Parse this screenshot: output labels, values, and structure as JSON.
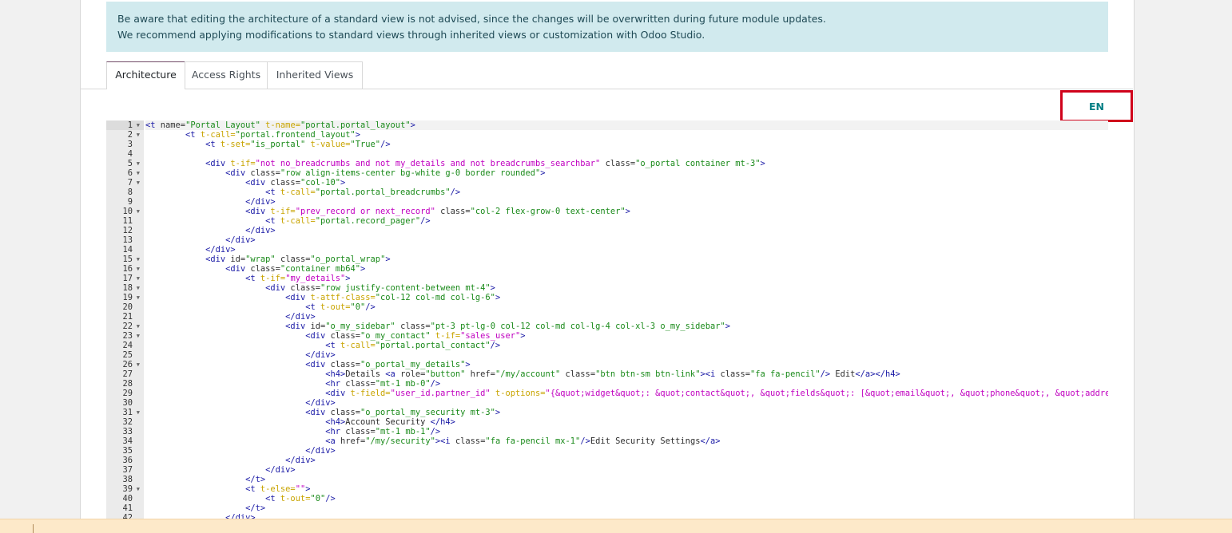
{
  "alert": {
    "line1": "Be aware that editing the architecture of a standard view is not advised, since the changes will be overwritten during future module updates.",
    "line2": "We recommend applying modifications to standard views through inherited views or customization with Odoo Studio."
  },
  "tabs": [
    {
      "label": "Architecture"
    },
    {
      "label": "Access Rights"
    },
    {
      "label": "Inherited Views"
    }
  ],
  "lang_button": {
    "label": "EN"
  },
  "code": {
    "lines": [
      {
        "n": "1",
        "fold": true,
        "tokens": [
          [
            "tag",
            "<t"
          ],
          [
            "attr",
            " name="
          ],
          [
            "str",
            "\"Portal Layout\""
          ],
          [
            "qattr",
            " t-name="
          ],
          [
            "str",
            "\"portal.portal_layout\""
          ],
          [
            "tag",
            ">"
          ]
        ]
      },
      {
        "n": "2",
        "fold": true,
        "tokens": [
          [
            "plain",
            "        "
          ],
          [
            "tag",
            "<t"
          ],
          [
            "qattr",
            " t-call="
          ],
          [
            "str",
            "\"portal.frontend_layout\""
          ],
          [
            "tag",
            ">"
          ]
        ]
      },
      {
        "n": "3",
        "fold": false,
        "tokens": [
          [
            "plain",
            "            "
          ],
          [
            "tag",
            "<t"
          ],
          [
            "qattr",
            " t-set="
          ],
          [
            "str",
            "\"is_portal\""
          ],
          [
            "qattr",
            " t-value="
          ],
          [
            "str",
            "\"True\""
          ],
          [
            "tag",
            "/>"
          ]
        ]
      },
      {
        "n": "4",
        "fold": false,
        "tokens": []
      },
      {
        "n": "5",
        "fold": true,
        "tokens": [
          [
            "plain",
            "            "
          ],
          [
            "tag",
            "<div"
          ],
          [
            "qattr",
            " t-if="
          ],
          [
            "qstr",
            "\"not no_breadcrumbs and not my_details and not breadcrumbs_searchbar\""
          ],
          [
            "attr",
            " class="
          ],
          [
            "str",
            "\"o_portal container mt-3\""
          ],
          [
            "tag",
            ">"
          ]
        ]
      },
      {
        "n": "6",
        "fold": true,
        "tokens": [
          [
            "plain",
            "                "
          ],
          [
            "tag",
            "<div"
          ],
          [
            "attr",
            " class="
          ],
          [
            "str",
            "\"row align-items-center bg-white g-0 border rounded\""
          ],
          [
            "tag",
            ">"
          ]
        ]
      },
      {
        "n": "7",
        "fold": true,
        "tokens": [
          [
            "plain",
            "                    "
          ],
          [
            "tag",
            "<div"
          ],
          [
            "attr",
            " class="
          ],
          [
            "str",
            "\"col-10\""
          ],
          [
            "tag",
            ">"
          ]
        ]
      },
      {
        "n": "8",
        "fold": false,
        "tokens": [
          [
            "plain",
            "                        "
          ],
          [
            "tag",
            "<t"
          ],
          [
            "qattr",
            " t-call="
          ],
          [
            "str",
            "\"portal.portal_breadcrumbs\""
          ],
          [
            "tag",
            "/>"
          ]
        ]
      },
      {
        "n": "9",
        "fold": false,
        "tokens": [
          [
            "plain",
            "                    "
          ],
          [
            "tag",
            "</div>"
          ]
        ]
      },
      {
        "n": "10",
        "fold": true,
        "tokens": [
          [
            "plain",
            "                    "
          ],
          [
            "tag",
            "<div"
          ],
          [
            "qattr",
            " t-if="
          ],
          [
            "qstr",
            "\"prev_record or next_record\""
          ],
          [
            "attr",
            " class="
          ],
          [
            "str",
            "\"col-2 flex-grow-0 text-center\""
          ],
          [
            "tag",
            ">"
          ]
        ]
      },
      {
        "n": "11",
        "fold": false,
        "tokens": [
          [
            "plain",
            "                        "
          ],
          [
            "tag",
            "<t"
          ],
          [
            "qattr",
            " t-call="
          ],
          [
            "str",
            "\"portal.record_pager\""
          ],
          [
            "tag",
            "/>"
          ]
        ]
      },
      {
        "n": "12",
        "fold": false,
        "tokens": [
          [
            "plain",
            "                    "
          ],
          [
            "tag",
            "</div>"
          ]
        ]
      },
      {
        "n": "13",
        "fold": false,
        "tokens": [
          [
            "plain",
            "                "
          ],
          [
            "tag",
            "</div>"
          ]
        ]
      },
      {
        "n": "14",
        "fold": false,
        "tokens": [
          [
            "plain",
            "            "
          ],
          [
            "tag",
            "</div>"
          ]
        ]
      },
      {
        "n": "15",
        "fold": true,
        "tokens": [
          [
            "plain",
            "            "
          ],
          [
            "tag",
            "<div"
          ],
          [
            "attr",
            " id="
          ],
          [
            "str",
            "\"wrap\""
          ],
          [
            "attr",
            " class="
          ],
          [
            "str",
            "\"o_portal_wrap\""
          ],
          [
            "tag",
            ">"
          ]
        ]
      },
      {
        "n": "16",
        "fold": true,
        "tokens": [
          [
            "plain",
            "                "
          ],
          [
            "tag",
            "<div"
          ],
          [
            "attr",
            " class="
          ],
          [
            "str",
            "\"container mb64\""
          ],
          [
            "tag",
            ">"
          ]
        ]
      },
      {
        "n": "17",
        "fold": true,
        "tokens": [
          [
            "plain",
            "                    "
          ],
          [
            "tag",
            "<t"
          ],
          [
            "qattr",
            " t-if="
          ],
          [
            "qstr",
            "\"my_details\""
          ],
          [
            "tag",
            ">"
          ]
        ]
      },
      {
        "n": "18",
        "fold": true,
        "tokens": [
          [
            "plain",
            "                        "
          ],
          [
            "tag",
            "<div"
          ],
          [
            "attr",
            " class="
          ],
          [
            "str",
            "\"row justify-content-between mt-4\""
          ],
          [
            "tag",
            ">"
          ]
        ]
      },
      {
        "n": "19",
        "fold": true,
        "tokens": [
          [
            "plain",
            "                            "
          ],
          [
            "tag",
            "<div"
          ],
          [
            "qattr",
            " t-attf-class="
          ],
          [
            "str",
            "\"col-12 col-md col-lg-6\""
          ],
          [
            "tag",
            ">"
          ]
        ]
      },
      {
        "n": "20",
        "fold": false,
        "tokens": [
          [
            "plain",
            "                                "
          ],
          [
            "tag",
            "<t"
          ],
          [
            "qattr",
            " t-out="
          ],
          [
            "str",
            "\"0\""
          ],
          [
            "tag",
            "/>"
          ]
        ]
      },
      {
        "n": "21",
        "fold": false,
        "tokens": [
          [
            "plain",
            "                            "
          ],
          [
            "tag",
            "</div>"
          ]
        ]
      },
      {
        "n": "22",
        "fold": true,
        "tokens": [
          [
            "plain",
            "                            "
          ],
          [
            "tag",
            "<div"
          ],
          [
            "attr",
            " id="
          ],
          [
            "str",
            "\"o_my_sidebar\""
          ],
          [
            "attr",
            " class="
          ],
          [
            "str",
            "\"pt-3 pt-lg-0 col-12 col-md col-lg-4 col-xl-3 o_my_sidebar\""
          ],
          [
            "tag",
            ">"
          ]
        ]
      },
      {
        "n": "23",
        "fold": true,
        "tokens": [
          [
            "plain",
            "                                "
          ],
          [
            "tag",
            "<div"
          ],
          [
            "attr",
            " class="
          ],
          [
            "str",
            "\"o_my_contact\""
          ],
          [
            "qattr",
            " t-if="
          ],
          [
            "qstr",
            "\"sales_user\""
          ],
          [
            "tag",
            ">"
          ]
        ]
      },
      {
        "n": "24",
        "fold": false,
        "tokens": [
          [
            "plain",
            "                                    "
          ],
          [
            "tag",
            "<t"
          ],
          [
            "qattr",
            " t-call="
          ],
          [
            "str",
            "\"portal.portal_contact\""
          ],
          [
            "tag",
            "/>"
          ]
        ]
      },
      {
        "n": "25",
        "fold": false,
        "tokens": [
          [
            "plain",
            "                                "
          ],
          [
            "tag",
            "</div>"
          ]
        ]
      },
      {
        "n": "26",
        "fold": true,
        "tokens": [
          [
            "plain",
            "                                "
          ],
          [
            "tag",
            "<div"
          ],
          [
            "attr",
            " class="
          ],
          [
            "str",
            "\"o_portal_my_details\""
          ],
          [
            "tag",
            ">"
          ]
        ]
      },
      {
        "n": "27",
        "fold": false,
        "tokens": [
          [
            "plain",
            "                                    "
          ],
          [
            "tag",
            "<h4>"
          ],
          [
            "plain",
            "Details "
          ],
          [
            "tag",
            "<a"
          ],
          [
            "attr",
            " role="
          ],
          [
            "str",
            "\"button\""
          ],
          [
            "attr",
            " href="
          ],
          [
            "str",
            "\"/my/account\""
          ],
          [
            "attr",
            " class="
          ],
          [
            "str",
            "\"btn btn-sm btn-link\""
          ],
          [
            "tag",
            "><i"
          ],
          [
            "attr",
            " class="
          ],
          [
            "str",
            "\"fa fa-pencil\""
          ],
          [
            "tag",
            "/>"
          ],
          [
            "plain",
            " Edit"
          ],
          [
            "tag",
            "</a></h4>"
          ]
        ]
      },
      {
        "n": "28",
        "fold": false,
        "tokens": [
          [
            "plain",
            "                                    "
          ],
          [
            "tag",
            "<hr"
          ],
          [
            "attr",
            " class="
          ],
          [
            "str",
            "\"mt-1 mb-0\""
          ],
          [
            "tag",
            "/>"
          ]
        ]
      },
      {
        "n": "29",
        "fold": false,
        "tokens": [
          [
            "plain",
            "                                    "
          ],
          [
            "tag",
            "<div"
          ],
          [
            "qattr",
            " t-field="
          ],
          [
            "qstr",
            "\"user_id.partner_id\""
          ],
          [
            "qattr",
            " t-options="
          ],
          [
            "qstr",
            "\"{&quot;widget&quot;: &quot;contact&quot;, &quot;fields&quot;: [&quot;email&quot;, &quot;phone&quot;, &quot;address&quot;"
          ]
        ]
      },
      {
        "n": "30",
        "fold": false,
        "tokens": [
          [
            "plain",
            "                                "
          ],
          [
            "tag",
            "</div>"
          ]
        ]
      },
      {
        "n": "31",
        "fold": true,
        "tokens": [
          [
            "plain",
            "                                "
          ],
          [
            "tag",
            "<div"
          ],
          [
            "attr",
            " class="
          ],
          [
            "str",
            "\"o_portal_my_security mt-3\""
          ],
          [
            "tag",
            ">"
          ]
        ]
      },
      {
        "n": "32",
        "fold": false,
        "tokens": [
          [
            "plain",
            "                                    "
          ],
          [
            "tag",
            "<h4>"
          ],
          [
            "plain",
            "Account Security "
          ],
          [
            "tag",
            "</h4>"
          ]
        ]
      },
      {
        "n": "33",
        "fold": false,
        "tokens": [
          [
            "plain",
            "                                    "
          ],
          [
            "tag",
            "<hr"
          ],
          [
            "attr",
            " class="
          ],
          [
            "str",
            "\"mt-1 mb-1\""
          ],
          [
            "tag",
            "/>"
          ]
        ]
      },
      {
        "n": "34",
        "fold": false,
        "tokens": [
          [
            "plain",
            "                                    "
          ],
          [
            "tag",
            "<a"
          ],
          [
            "attr",
            " href="
          ],
          [
            "str",
            "\"/my/security\""
          ],
          [
            "tag",
            "><i"
          ],
          [
            "attr",
            " class="
          ],
          [
            "str",
            "\"fa fa-pencil mx-1\""
          ],
          [
            "tag",
            "/>"
          ],
          [
            "plain",
            "Edit Security Settings"
          ],
          [
            "tag",
            "</a>"
          ]
        ]
      },
      {
        "n": "35",
        "fold": false,
        "tokens": [
          [
            "plain",
            "                                "
          ],
          [
            "tag",
            "</div>"
          ]
        ]
      },
      {
        "n": "36",
        "fold": false,
        "tokens": [
          [
            "plain",
            "                            "
          ],
          [
            "tag",
            "</div>"
          ]
        ]
      },
      {
        "n": "37",
        "fold": false,
        "tokens": [
          [
            "plain",
            "                        "
          ],
          [
            "tag",
            "</div>"
          ]
        ]
      },
      {
        "n": "38",
        "fold": false,
        "tokens": [
          [
            "plain",
            "                    "
          ],
          [
            "tag",
            "</t>"
          ]
        ]
      },
      {
        "n": "39",
        "fold": true,
        "tokens": [
          [
            "plain",
            "                    "
          ],
          [
            "tag",
            "<t"
          ],
          [
            "qattr",
            " t-else="
          ],
          [
            "qstr",
            "\"\""
          ],
          [
            "tag",
            ">"
          ]
        ]
      },
      {
        "n": "40",
        "fold": false,
        "tokens": [
          [
            "plain",
            "                        "
          ],
          [
            "tag",
            "<t"
          ],
          [
            "qattr",
            " t-out="
          ],
          [
            "str",
            "\"0\""
          ],
          [
            "tag",
            "/>"
          ]
        ]
      },
      {
        "n": "41",
        "fold": false,
        "tokens": [
          [
            "plain",
            "                    "
          ],
          [
            "tag",
            "</t>"
          ]
        ]
      },
      {
        "n": "42",
        "fold": false,
        "tokens": [
          [
            "plain",
            "                "
          ],
          [
            "tag",
            "</div>"
          ]
        ]
      }
    ]
  }
}
